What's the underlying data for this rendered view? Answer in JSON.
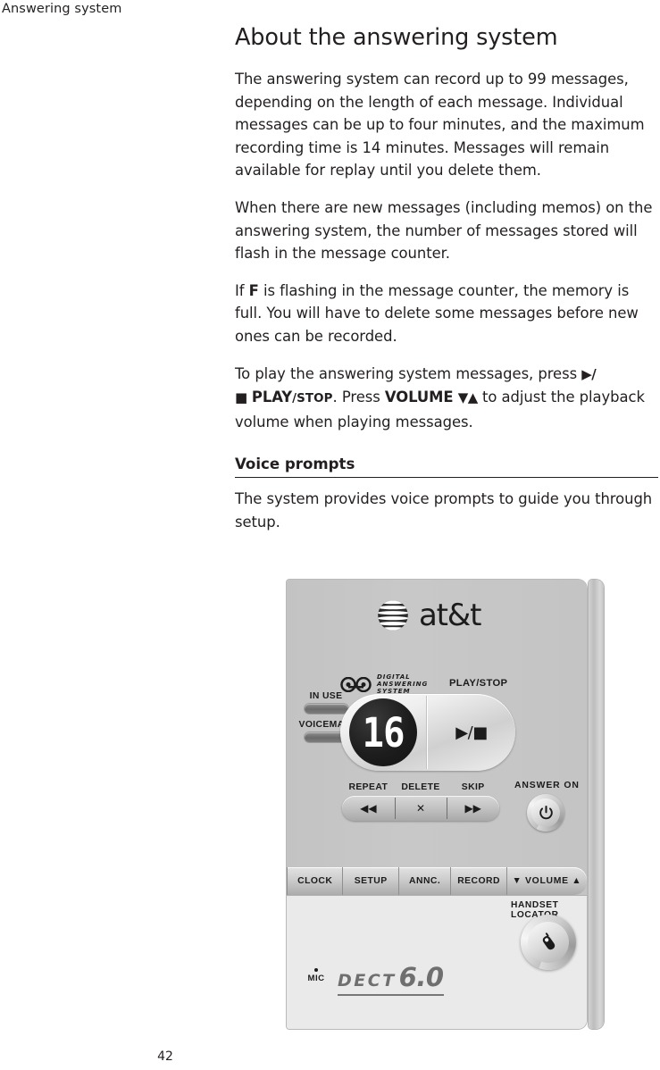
{
  "running_header": "Answering system",
  "page_number": "42",
  "main": {
    "title": "About the answering system",
    "paragraphs": [
      "The answering system can record up to 99 messages, depending on the length of each message. Individual messages can be up to four minutes, and the maximum recording time is 14 minutes. Messages will remain available for replay until you delete them.",
      "When there are new messages (including memos) on the answering system, the number of messages stored will flash in the message counter."
    ],
    "memory_full_note": {
      "before": "If ",
      "flag": "F",
      "after": " is flashing in the message counter, the memory is full. You will have to delete some messages before new ones can be recorded."
    },
    "play_note": {
      "lead": "To play the answering system messages, press ",
      "play_glyph": "▶/■",
      "play_label": "PLAY",
      "play_slash": "/",
      "stop_label": "STOP",
      "mid": ". Press ",
      "volume_label": "VOLUME",
      "volume_glyph": "▼▲",
      "tail": " to adjust the playback volume when playing messages."
    },
    "subsection": {
      "heading": "Voice prompts",
      "text": "The system provides voice prompts to guide you through setup."
    }
  },
  "device": {
    "brand": "at&t",
    "answering_mark": {
      "line1": "DIGITAL",
      "line2": "ANSWERING",
      "line3": "SYSTEM"
    },
    "play_stop_label": "PLAY/STOP",
    "indicators": [
      {
        "label": "IN USE"
      },
      {
        "label": "VOICEMAIL"
      }
    ],
    "display_value": "16",
    "play_stop_glyph": "▶/■",
    "transport": [
      {
        "label": "REPEAT",
        "glyph": "◀◀"
      },
      {
        "label": "DELETE",
        "glyph": "✕"
      },
      {
        "label": "SKIP",
        "glyph": "▶▶"
      }
    ],
    "answer_on_label": "ANSWER ON",
    "function_keys": [
      "CLOCK",
      "SETUP",
      "ANNC.",
      "RECORD",
      "▼ VOLUME ▲"
    ],
    "handset_locator_label": "HANDSET LOCATOR",
    "mic_label": "MIC",
    "dect_word": "DECT",
    "dect_version": "6.0"
  }
}
